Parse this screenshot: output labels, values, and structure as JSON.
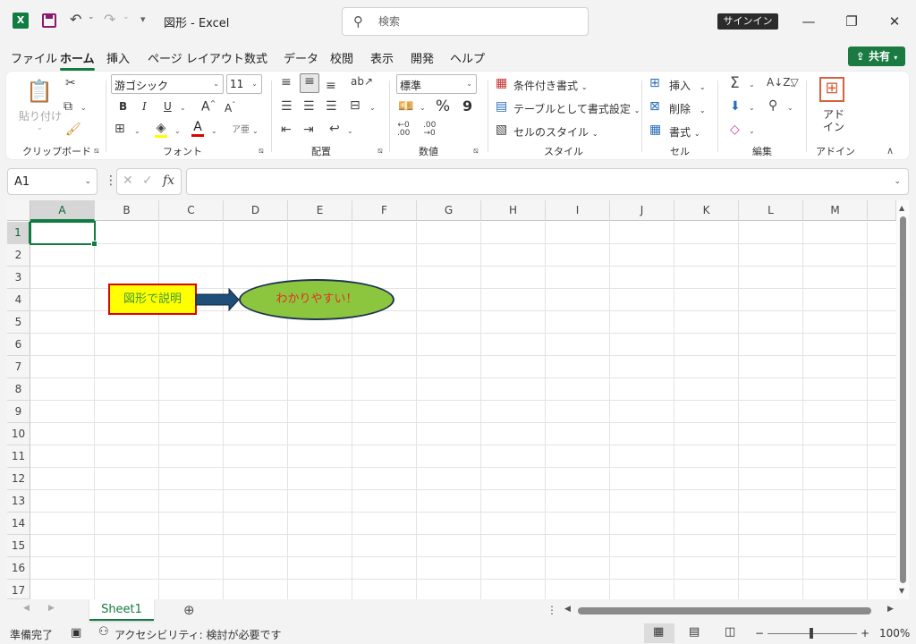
{
  "titlebar": {
    "title": "図形  -  Excel",
    "search_placeholder": "検索",
    "signin": "サインイン",
    "icons": [
      "excel-logo",
      "save-icon",
      "undo-icon",
      "redo-icon",
      "customize-icon",
      "minimize-icon",
      "restore-icon",
      "close-icon"
    ]
  },
  "menu": {
    "tabs": [
      "ファイル",
      "ホーム",
      "挿入",
      "ページ レイアウト",
      "数式",
      "データ",
      "校閲",
      "表示",
      "開発",
      "ヘルプ"
    ],
    "active": "ホーム",
    "share": "共有"
  },
  "ribbon": {
    "clipboard": {
      "label": "クリップボード",
      "paste": "貼り付け"
    },
    "font": {
      "label": "フォント",
      "name": "游ゴシック",
      "size": "11",
      "bold": "B",
      "italic": "I",
      "underline": "U",
      "grow": "A",
      "shrink": "A"
    },
    "alignment": {
      "label": "配置"
    },
    "number": {
      "label": "数値",
      "format": "標準",
      "percent": "%",
      "comma": "9"
    },
    "styles": {
      "label": "スタイル",
      "conditional": "条件付き書式",
      "as_table": "テーブルとして書式設定",
      "cell_styles": "セルのスタイル"
    },
    "cells": {
      "label": "セル",
      "insert": "挿入",
      "delete": "削除",
      "format": "書式"
    },
    "editing": {
      "label": "編集"
    },
    "addins": {
      "label": "アドイン",
      "button_line1": "アド",
      "button_line2": "イン"
    }
  },
  "formula_bar": {
    "name_box": "A1",
    "fx": "fx",
    "value": ""
  },
  "grid": {
    "columns": [
      "A",
      "B",
      "C",
      "D",
      "E",
      "F",
      "G",
      "H",
      "I",
      "J",
      "K",
      "L",
      "M"
    ],
    "rows": [
      "1",
      "2",
      "3",
      "4",
      "5",
      "6",
      "7",
      "8",
      "9",
      "10",
      "11",
      "12",
      "13",
      "14",
      "15",
      "16",
      "17"
    ],
    "selected_cell": "A1"
  },
  "shapes": {
    "rect_text": "図形で説明",
    "ellipse_text": "わかりやすい！",
    "colors": {
      "rect_fill": "#ffff00",
      "rect_border": "#e00000",
      "rect_text": "#3a9a3a",
      "arrow_fill": "#1f4e79",
      "ellipse_fill": "#8cc63f",
      "ellipse_border": "#1f3350",
      "ellipse_text": "#e03020"
    }
  },
  "sheets": {
    "tabs": [
      "Sheet1"
    ],
    "active": "Sheet1"
  },
  "status": {
    "ready": "準備完了",
    "accessibility": "アクセシビリティ: 検討が必要です",
    "zoom": "100%"
  },
  "accent": "#107c41"
}
